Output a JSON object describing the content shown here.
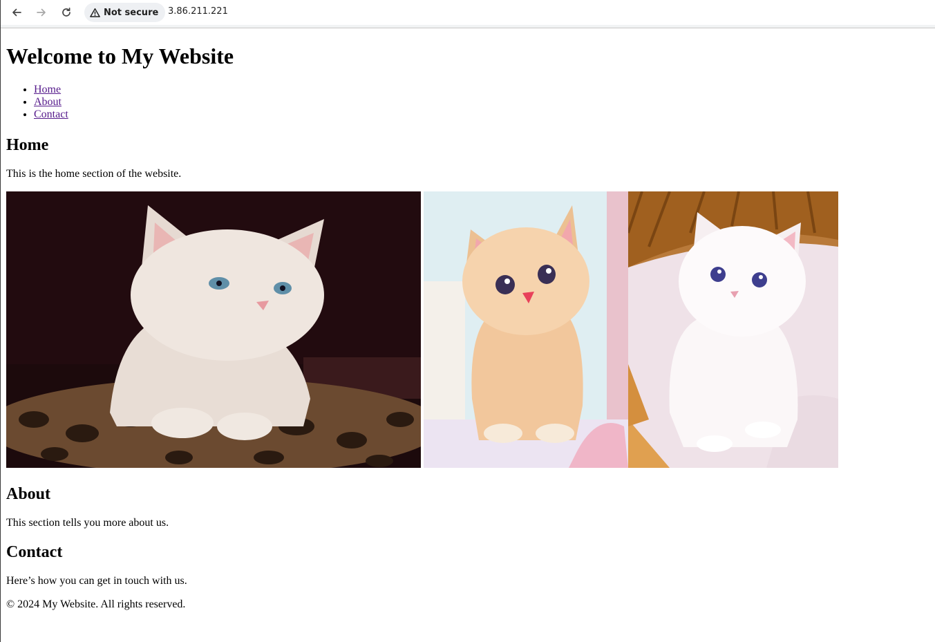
{
  "browser": {
    "security_label": "Not secure",
    "url": "3.86.211.221"
  },
  "page": {
    "title": "Welcome to My Website",
    "nav": [
      "Home",
      "About",
      "Contact"
    ],
    "home": {
      "heading": "Home",
      "text": "This is the home section of the website."
    },
    "images": [
      {
        "subject": "cream kitten with blue eyes on leopard-print cushion"
      },
      {
        "subject": "orange tabby kitten sitting"
      },
      {
        "subject": "white kitten in wicker basket"
      }
    ],
    "about": {
      "heading": "About",
      "text": "This section tells you more about us."
    },
    "contact": {
      "heading": "Contact",
      "text": "Here’s how you can get in touch with us."
    },
    "footer": "© 2024 My Website. All rights reserved."
  }
}
